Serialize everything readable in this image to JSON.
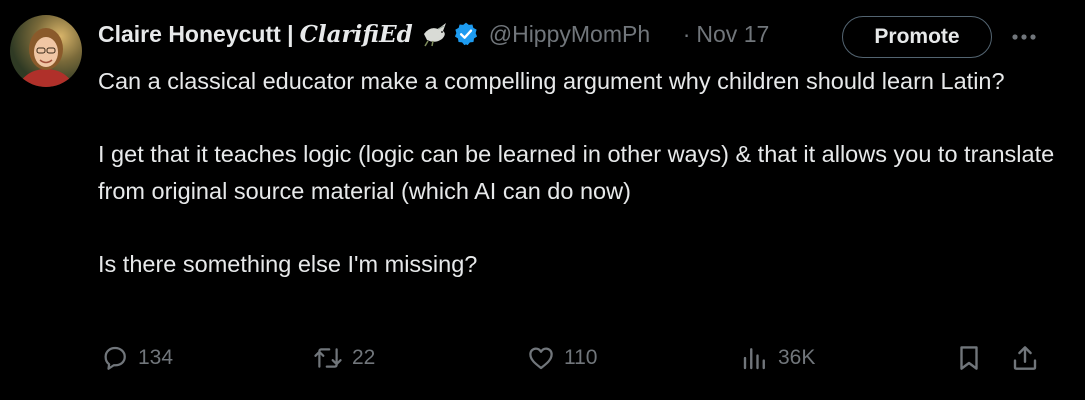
{
  "author": {
    "display_name": "Claire Honeycutt |",
    "name_decoration": "ClarifiEd",
    "handle": "@HippyMomPh",
    "separator": "·",
    "date": "Nov 17"
  },
  "header_buttons": {
    "promote_label": "Promote",
    "more_icon": "more-horizontal-icon"
  },
  "tweet": {
    "paragraphs": [
      "Can a classical educator make a compelling argument why children should learn Latin?",
      "I get that it teaches logic (logic can be learned in other ways) & that it allows you to translate from original source material (which AI can do now)",
      "Is there something else I'm missing?"
    ]
  },
  "actions": {
    "replies": {
      "icon": "reply-icon",
      "count": "134"
    },
    "reposts": {
      "icon": "repost-icon",
      "count": "22"
    },
    "likes": {
      "icon": "like-icon",
      "count": "110"
    },
    "views": {
      "icon": "views-icon",
      "count": "36K"
    },
    "bookmark": {
      "icon": "bookmark-icon"
    },
    "share": {
      "icon": "share-icon"
    }
  },
  "colors": {
    "background": "#000000",
    "text_primary": "#e7e9ea",
    "text_secondary": "#71767b",
    "verified_blue": "#1d9bf0",
    "button_border": "#536471"
  }
}
